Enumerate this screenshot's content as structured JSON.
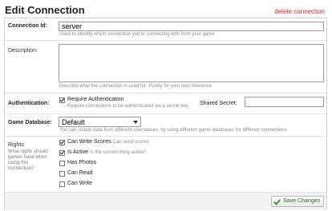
{
  "page": {
    "title": "Edit Connection",
    "delete_label": "delete connection"
  },
  "connection_id": {
    "label": "Connection Id:",
    "value": "server",
    "hint": "Used to identify which connection you're connecting with from your game"
  },
  "description": {
    "label": "Description:",
    "value": "",
    "hint": "Describe what the connection is used for: Purely for your own reference"
  },
  "authentication": {
    "label": "Authentication:",
    "checkbox_label": "Require Authentication",
    "checked": true,
    "hint": "Require connections to be authenticated via a secret key",
    "secret_label": "Shared Secret:",
    "secret_value": ""
  },
  "game_database": {
    "label": "Game Database:",
    "selected": "Default",
    "hint": "You can isolate data from different usersbases, by using different game databases for different connections."
  },
  "rights": {
    "label": "Rights",
    "hint": "What rights should games have when using this connection?",
    "items": [
      {
        "label": "Can Write Scores",
        "desc": "Can send scores",
        "checked": true
      },
      {
        "label": "Is Active",
        "desc": "Is the current thing active?",
        "checked": true
      },
      {
        "label": "Has Photos",
        "desc": "",
        "checked": false
      },
      {
        "label": "Can Read",
        "desc": "",
        "checked": false
      },
      {
        "label": "Can Write",
        "desc": "",
        "checked": false
      }
    ]
  },
  "footer": {
    "save_label": "Save Changes"
  },
  "colors": {
    "delete_link": "#cc2222",
    "panel_border": "#cfcfcf",
    "save_text": "#2a6a2a",
    "check_icon": "#3a9a3a"
  }
}
